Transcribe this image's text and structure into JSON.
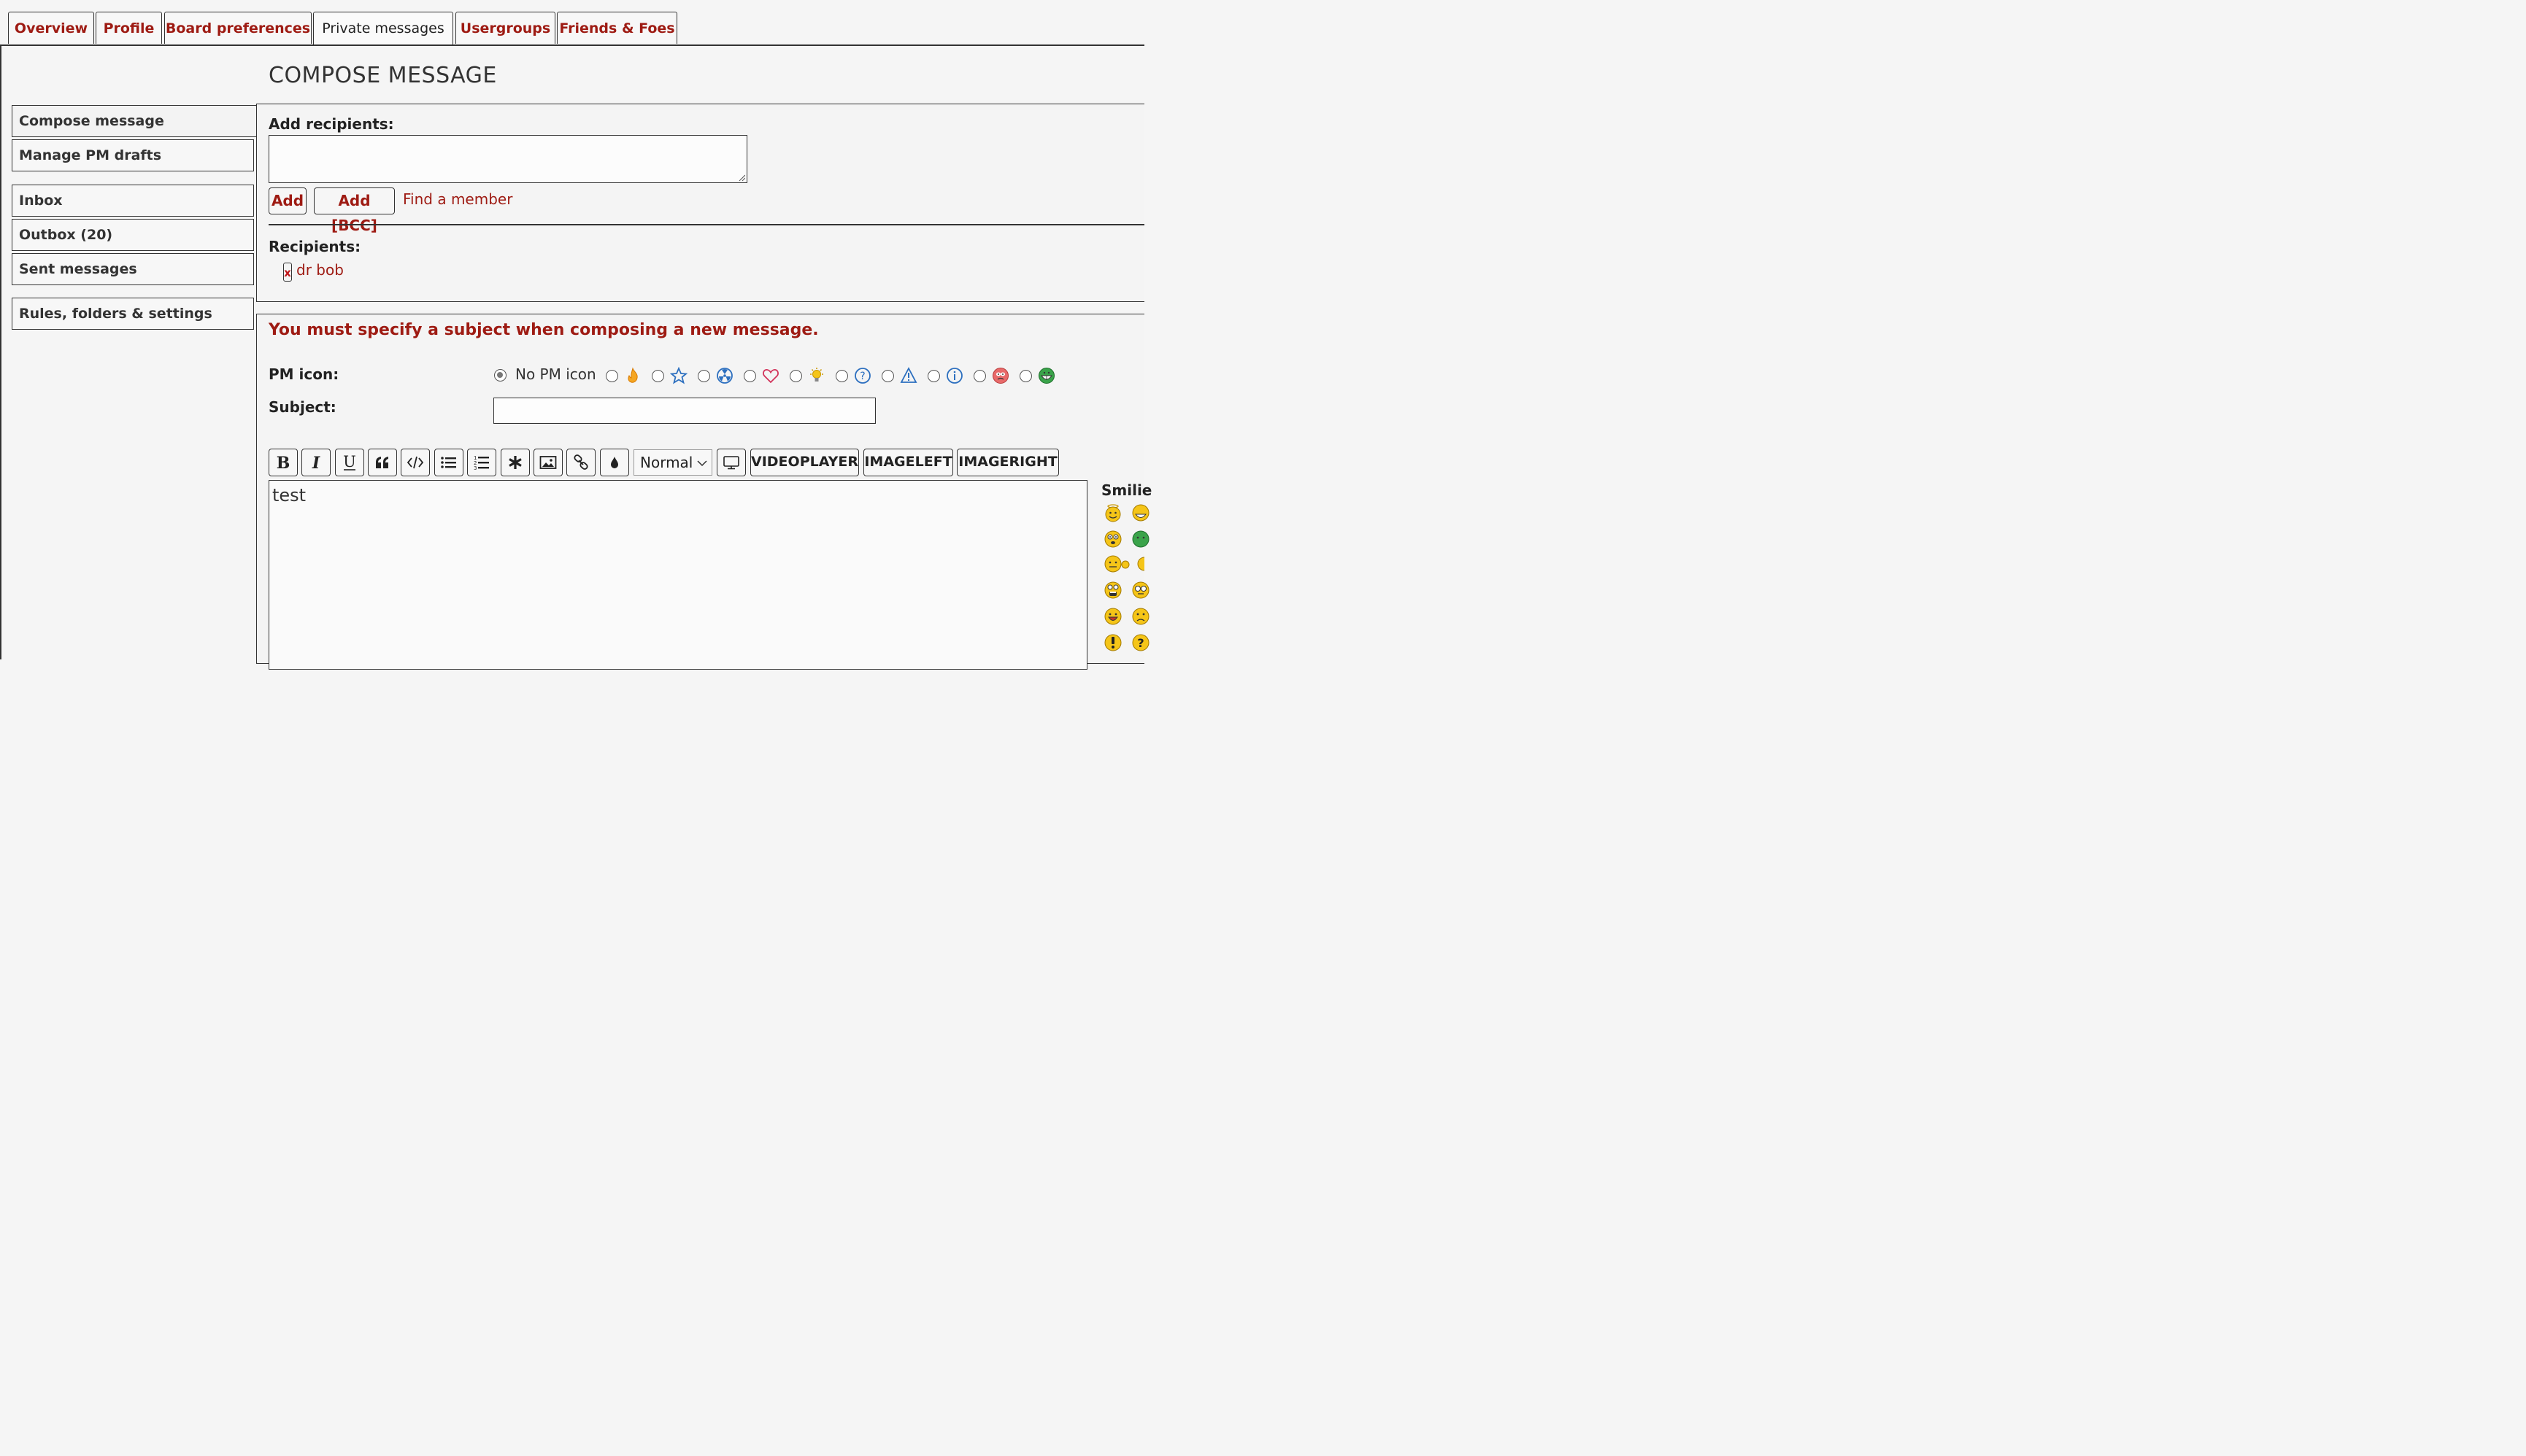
{
  "tabs": [
    {
      "label": "Overview"
    },
    {
      "label": "Profile"
    },
    {
      "label": "Board preferences"
    },
    {
      "label": "Private messages"
    },
    {
      "label": "Usergroups"
    },
    {
      "label": "Friends & Foes"
    }
  ],
  "page_title": "COMPOSE MESSAGE",
  "sidebar": {
    "items": [
      {
        "label": "Compose message"
      },
      {
        "label": "Manage PM drafts"
      },
      {
        "label": "Inbox"
      },
      {
        "label": "Outbox (20)"
      },
      {
        "label": "Sent messages"
      },
      {
        "label": "Rules, folders & settings"
      }
    ]
  },
  "recipients_box": {
    "add_label": "Add recipients:",
    "add_button": "Add",
    "add_bcc_button": "Add [BCC]",
    "find_member": "Find a member",
    "recipients_label": "Recipients:",
    "remove_symbol": "x",
    "recipient": "dr bob"
  },
  "compose": {
    "error": "You must specify a subject when composing a new message.",
    "pm_icon_label": "PM icon:",
    "no_icon_label": "No PM icon",
    "subject_label": "Subject:",
    "font_size": "Normal",
    "btn_videoplayer": "VIDEOPLAYER",
    "btn_imageleft": "IMAGELEFT",
    "btn_imageright": "IMAGERIGHT",
    "body": "test",
    "smilies_label": "Smilie"
  },
  "colors": {
    "accent": "#9e1b13",
    "border": "#333333",
    "background": "#f5f5f5"
  }
}
